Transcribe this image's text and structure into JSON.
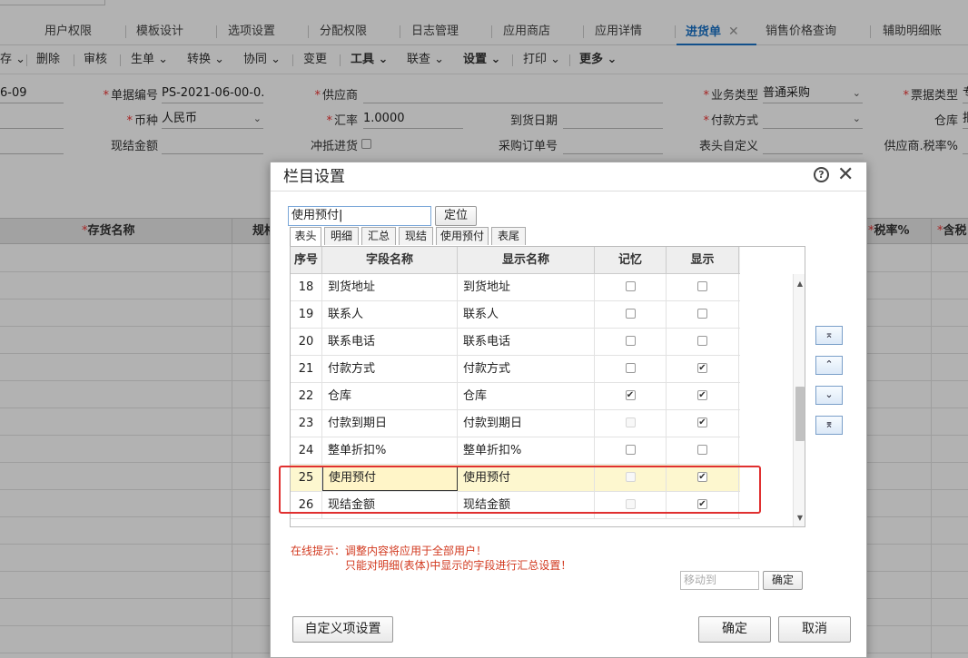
{
  "tabs": [
    {
      "label": "用户权限"
    },
    {
      "label": "模板设计"
    },
    {
      "label": "选项设置"
    },
    {
      "label": "分配权限"
    },
    {
      "label": "日志管理"
    },
    {
      "label": "应用商店"
    },
    {
      "label": "应用详情"
    },
    {
      "label": "进货单",
      "active": true
    },
    {
      "label": "销售价格查询"
    },
    {
      "label": "辅助明细账"
    }
  ],
  "toolbar": {
    "items": [
      "存",
      "删除",
      "审核",
      "生单",
      "转换",
      "协同",
      "变更",
      "工具",
      "联查",
      "设置",
      "打印",
      "更多"
    ]
  },
  "form": {
    "date_value": "6-09",
    "doc_no_label": "单据编号",
    "doc_no_value": "PS-2021-06-00-0...",
    "supplier_label": "供应商",
    "biz_type_label": "业务类型",
    "biz_type_value": "普通采购",
    "invoice_type_label": "票据类型",
    "invoice_type_value": "专",
    "currency_label": "币种",
    "currency_value": "人民币",
    "rate_label": "汇率",
    "rate_value": "1.0000",
    "arrival_date_label": "到货日期",
    "payment_label": "付款方式",
    "warehouse_label": "仓库",
    "warehouse_value": "批",
    "cash_amount_label": "现结金额",
    "offset_label": "冲抵进货",
    "po_no_label": "采购订单号",
    "header_custom_label": "表头自定义",
    "supplier_tax_label": "供应商.税率%"
  },
  "grid": {
    "col_name": "存货名称",
    "col_spec": "规格",
    "col_tax": "税率%",
    "col_taxinc": "含税"
  },
  "dialog": {
    "title": "栏目设置",
    "help_icon": "?",
    "close_icon": "✕",
    "search_value": "使用预付",
    "locate_button": "定位",
    "subtabs": [
      "表头",
      "明细",
      "汇总",
      "现结",
      "使用预付",
      "表尾"
    ],
    "columns": {
      "no": "序号",
      "field": "字段名称",
      "display": "显示名称",
      "memory": "记忆",
      "show": "显示"
    },
    "rows": [
      {
        "no": "18",
        "field": "到货地址",
        "display": "到货地址",
        "memory": false,
        "memory_disabled": false,
        "show": false
      },
      {
        "no": "19",
        "field": "联系人",
        "display": "联系人",
        "memory": false,
        "memory_disabled": false,
        "show": false
      },
      {
        "no": "20",
        "field": "联系电话",
        "display": "联系电话",
        "memory": false,
        "memory_disabled": false,
        "show": false
      },
      {
        "no": "21",
        "field": "付款方式",
        "display": "付款方式",
        "memory": false,
        "memory_disabled": false,
        "show": true
      },
      {
        "no": "22",
        "field": "仓库",
        "display": "仓库",
        "memory": true,
        "memory_disabled": false,
        "show": true
      },
      {
        "no": "23",
        "field": "付款到期日",
        "display": "付款到期日",
        "memory": false,
        "memory_disabled": true,
        "show": true
      },
      {
        "no": "24",
        "field": "整单折扣%",
        "display": "整单折扣%",
        "memory": false,
        "memory_disabled": false,
        "show": false
      },
      {
        "no": "25",
        "field": "使用预付",
        "display": "使用预付",
        "memory": false,
        "memory_disabled": true,
        "show": true,
        "selected": true
      },
      {
        "no": "26",
        "field": "现结金额",
        "display": "现结金额",
        "memory": false,
        "memory_disabled": true,
        "show": true
      }
    ],
    "move_buttons": [
      "⌅",
      "⌃",
      "⌄",
      "⌆"
    ],
    "tip_line1": "在线提示：调整内容将应用于全部用户！",
    "tip_line2": "只能对明细(表体)中显示的字段进行汇总设置！",
    "move_to_placeholder": "移动到",
    "move_confirm": "确定",
    "custom_button": "自定义项设置",
    "ok_button": "确定",
    "cancel_button": "取消"
  }
}
